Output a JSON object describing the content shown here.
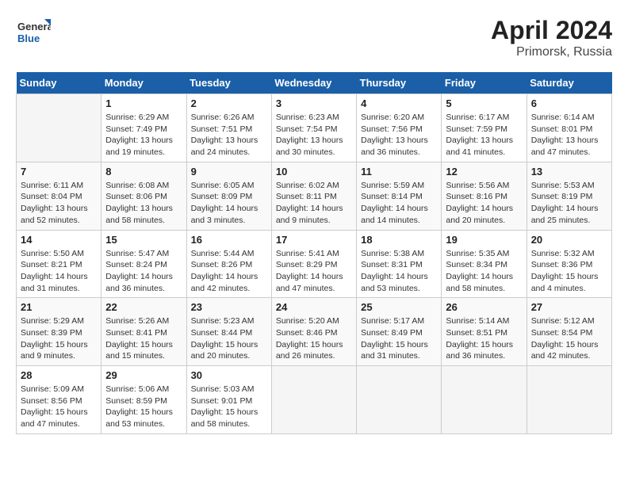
{
  "header": {
    "logo_general": "General",
    "logo_blue": "Blue",
    "month_year": "April 2024",
    "location": "Primorsk, Russia"
  },
  "weekdays": [
    "Sunday",
    "Monday",
    "Tuesday",
    "Wednesday",
    "Thursday",
    "Friday",
    "Saturday"
  ],
  "weeks": [
    [
      {
        "day": "",
        "sunrise": "",
        "sunset": "",
        "daylight": ""
      },
      {
        "day": "1",
        "sunrise": "Sunrise: 6:29 AM",
        "sunset": "Sunset: 7:49 PM",
        "daylight": "Daylight: 13 hours and 19 minutes."
      },
      {
        "day": "2",
        "sunrise": "Sunrise: 6:26 AM",
        "sunset": "Sunset: 7:51 PM",
        "daylight": "Daylight: 13 hours and 24 minutes."
      },
      {
        "day": "3",
        "sunrise": "Sunrise: 6:23 AM",
        "sunset": "Sunset: 7:54 PM",
        "daylight": "Daylight: 13 hours and 30 minutes."
      },
      {
        "day": "4",
        "sunrise": "Sunrise: 6:20 AM",
        "sunset": "Sunset: 7:56 PM",
        "daylight": "Daylight: 13 hours and 36 minutes."
      },
      {
        "day": "5",
        "sunrise": "Sunrise: 6:17 AM",
        "sunset": "Sunset: 7:59 PM",
        "daylight": "Daylight: 13 hours and 41 minutes."
      },
      {
        "day": "6",
        "sunrise": "Sunrise: 6:14 AM",
        "sunset": "Sunset: 8:01 PM",
        "daylight": "Daylight: 13 hours and 47 minutes."
      }
    ],
    [
      {
        "day": "7",
        "sunrise": "Sunrise: 6:11 AM",
        "sunset": "Sunset: 8:04 PM",
        "daylight": "Daylight: 13 hours and 52 minutes."
      },
      {
        "day": "8",
        "sunrise": "Sunrise: 6:08 AM",
        "sunset": "Sunset: 8:06 PM",
        "daylight": "Daylight: 13 hours and 58 minutes."
      },
      {
        "day": "9",
        "sunrise": "Sunrise: 6:05 AM",
        "sunset": "Sunset: 8:09 PM",
        "daylight": "Daylight: 14 hours and 3 minutes."
      },
      {
        "day": "10",
        "sunrise": "Sunrise: 6:02 AM",
        "sunset": "Sunset: 8:11 PM",
        "daylight": "Daylight: 14 hours and 9 minutes."
      },
      {
        "day": "11",
        "sunrise": "Sunrise: 5:59 AM",
        "sunset": "Sunset: 8:14 PM",
        "daylight": "Daylight: 14 hours and 14 minutes."
      },
      {
        "day": "12",
        "sunrise": "Sunrise: 5:56 AM",
        "sunset": "Sunset: 8:16 PM",
        "daylight": "Daylight: 14 hours and 20 minutes."
      },
      {
        "day": "13",
        "sunrise": "Sunrise: 5:53 AM",
        "sunset": "Sunset: 8:19 PM",
        "daylight": "Daylight: 14 hours and 25 minutes."
      }
    ],
    [
      {
        "day": "14",
        "sunrise": "Sunrise: 5:50 AM",
        "sunset": "Sunset: 8:21 PM",
        "daylight": "Daylight: 14 hours and 31 minutes."
      },
      {
        "day": "15",
        "sunrise": "Sunrise: 5:47 AM",
        "sunset": "Sunset: 8:24 PM",
        "daylight": "Daylight: 14 hours and 36 minutes."
      },
      {
        "day": "16",
        "sunrise": "Sunrise: 5:44 AM",
        "sunset": "Sunset: 8:26 PM",
        "daylight": "Daylight: 14 hours and 42 minutes."
      },
      {
        "day": "17",
        "sunrise": "Sunrise: 5:41 AM",
        "sunset": "Sunset: 8:29 PM",
        "daylight": "Daylight: 14 hours and 47 minutes."
      },
      {
        "day": "18",
        "sunrise": "Sunrise: 5:38 AM",
        "sunset": "Sunset: 8:31 PM",
        "daylight": "Daylight: 14 hours and 53 minutes."
      },
      {
        "day": "19",
        "sunrise": "Sunrise: 5:35 AM",
        "sunset": "Sunset: 8:34 PM",
        "daylight": "Daylight: 14 hours and 58 minutes."
      },
      {
        "day": "20",
        "sunrise": "Sunrise: 5:32 AM",
        "sunset": "Sunset: 8:36 PM",
        "daylight": "Daylight: 15 hours and 4 minutes."
      }
    ],
    [
      {
        "day": "21",
        "sunrise": "Sunrise: 5:29 AM",
        "sunset": "Sunset: 8:39 PM",
        "daylight": "Daylight: 15 hours and 9 minutes."
      },
      {
        "day": "22",
        "sunrise": "Sunrise: 5:26 AM",
        "sunset": "Sunset: 8:41 PM",
        "daylight": "Daylight: 15 hours and 15 minutes."
      },
      {
        "day": "23",
        "sunrise": "Sunrise: 5:23 AM",
        "sunset": "Sunset: 8:44 PM",
        "daylight": "Daylight: 15 hours and 20 minutes."
      },
      {
        "day": "24",
        "sunrise": "Sunrise: 5:20 AM",
        "sunset": "Sunset: 8:46 PM",
        "daylight": "Daylight: 15 hours and 26 minutes."
      },
      {
        "day": "25",
        "sunrise": "Sunrise: 5:17 AM",
        "sunset": "Sunset: 8:49 PM",
        "daylight": "Daylight: 15 hours and 31 minutes."
      },
      {
        "day": "26",
        "sunrise": "Sunrise: 5:14 AM",
        "sunset": "Sunset: 8:51 PM",
        "daylight": "Daylight: 15 hours and 36 minutes."
      },
      {
        "day": "27",
        "sunrise": "Sunrise: 5:12 AM",
        "sunset": "Sunset: 8:54 PM",
        "daylight": "Daylight: 15 hours and 42 minutes."
      }
    ],
    [
      {
        "day": "28",
        "sunrise": "Sunrise: 5:09 AM",
        "sunset": "Sunset: 8:56 PM",
        "daylight": "Daylight: 15 hours and 47 minutes."
      },
      {
        "day": "29",
        "sunrise": "Sunrise: 5:06 AM",
        "sunset": "Sunset: 8:59 PM",
        "daylight": "Daylight: 15 hours and 53 minutes."
      },
      {
        "day": "30",
        "sunrise": "Sunrise: 5:03 AM",
        "sunset": "Sunset: 9:01 PM",
        "daylight": "Daylight: 15 hours and 58 minutes."
      },
      {
        "day": "",
        "sunrise": "",
        "sunset": "",
        "daylight": ""
      },
      {
        "day": "",
        "sunrise": "",
        "sunset": "",
        "daylight": ""
      },
      {
        "day": "",
        "sunrise": "",
        "sunset": "",
        "daylight": ""
      },
      {
        "day": "",
        "sunrise": "",
        "sunset": "",
        "daylight": ""
      }
    ]
  ]
}
